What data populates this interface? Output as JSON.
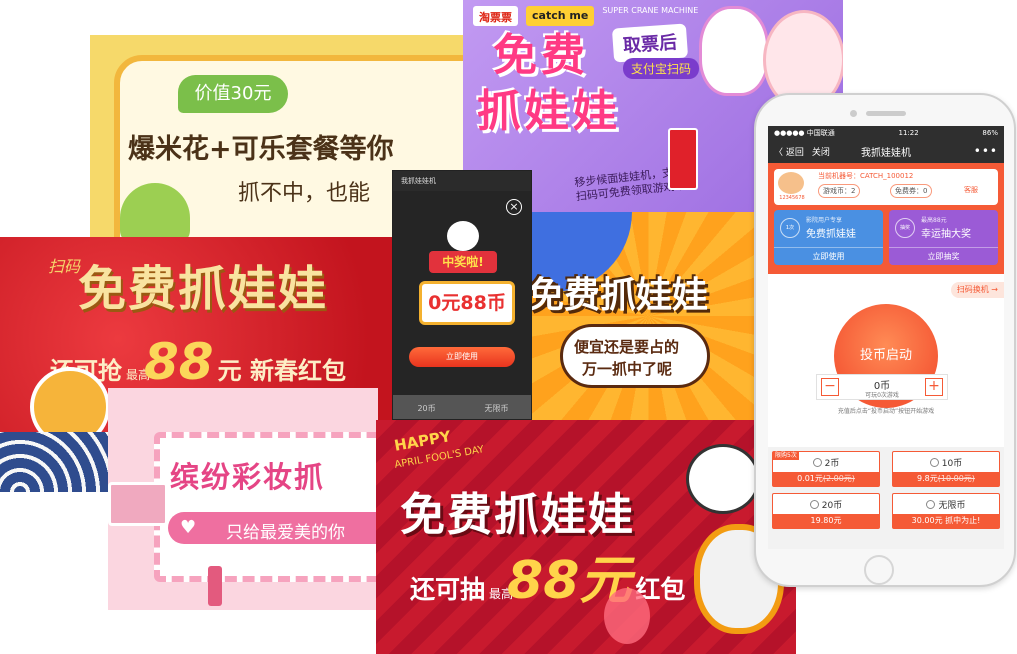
{
  "card_popcorn": {
    "tag": "价值30元",
    "title": "爆米花+可乐套餐等你",
    "subtitle": "抓不中，也能"
  },
  "card_taopiaopiao": {
    "logo_a": "淘票票",
    "logo_b": "catch me",
    "logo_b_sub": "SUPER CRANE MACHINE",
    "ticket_label": "取票后",
    "alipay_label": "支付宝扫码",
    "title_line1": "免费",
    "title_line2": "抓娃娃",
    "note_line1": "移步候面娃娃机，支付宝",
    "note_line2": "扫码可免费领取游戏币"
  },
  "card_cny": {
    "scan": "扫码",
    "title": "免费抓娃娃",
    "line2_prefix": "还可抢",
    "line2_max": "最高",
    "line2_amount": "88",
    "line2_suffix": "元 新春红包"
  },
  "card_popup": {
    "header": "我抓娃娃机",
    "close": "×",
    "ribbon": "中奖啦!",
    "prize": "0元88币",
    "use_button": "立即使用",
    "foot_left": "20币",
    "foot_right": "无限币"
  },
  "card_cheap": {
    "title": "免费抓娃娃",
    "bubble_line1": "便宜还是要占的",
    "bubble_line2": "万一抓中了呢"
  },
  "card_makeup": {
    "title": "缤纷彩妆抓",
    "subtitle": "只给最爱美的你"
  },
  "card_april": {
    "happy": "HAPPY",
    "april": "APRIL FOOL'S DAY",
    "title": "免费抓娃娃",
    "line2_prefix": "还可抽",
    "line2_max": "最高",
    "line2_amount": "88元",
    "line2_suffix": "红包"
  },
  "phone": {
    "status": {
      "carrier": "●●●●● 中国联通 ",
      "time": "11:22",
      "battery": "86%"
    },
    "nav": {
      "back": "〈 返回",
      "close": "关闭",
      "title": "我抓娃娃机",
      "more": "•••"
    },
    "info": {
      "uid": "12345678",
      "machine": "当前机器号：CATCH_100012",
      "game_coins_label": "游戏币：",
      "game_coins_value": "2",
      "free_coupons_label": "免费券：",
      "free_coupons_value": "0",
      "service": "客服"
    },
    "promo_left": {
      "icon_text": "1次",
      "small": "影院用户专享",
      "big": "免费抓娃娃",
      "action": "立即使用"
    },
    "promo_right": {
      "icon_text": "抽奖",
      "small": "最高88元",
      "big": "幸运抽大奖",
      "action": "立即抽奖"
    },
    "scan_button": "扫码换机 →",
    "coin_button": "投币启动",
    "stepper": {
      "minus": "−",
      "plus": "+",
      "value": "0币",
      "sub": "可玩0次游戏"
    },
    "hint": "充值后点击“投币启动”按钮开始游戏",
    "packs": [
      {
        "badge": "限购5次",
        "name": "2币",
        "price": "0.01元",
        "old": "(2.00元)"
      },
      {
        "badge": "",
        "name": "10币",
        "price": "9.8元",
        "old": "(10.00元)"
      },
      {
        "badge": "",
        "name": "20币",
        "price": "19.80元",
        "old": ""
      },
      {
        "badge": "",
        "name": "无限币",
        "price": "30.00元 抓中为止!",
        "old": ""
      }
    ]
  }
}
